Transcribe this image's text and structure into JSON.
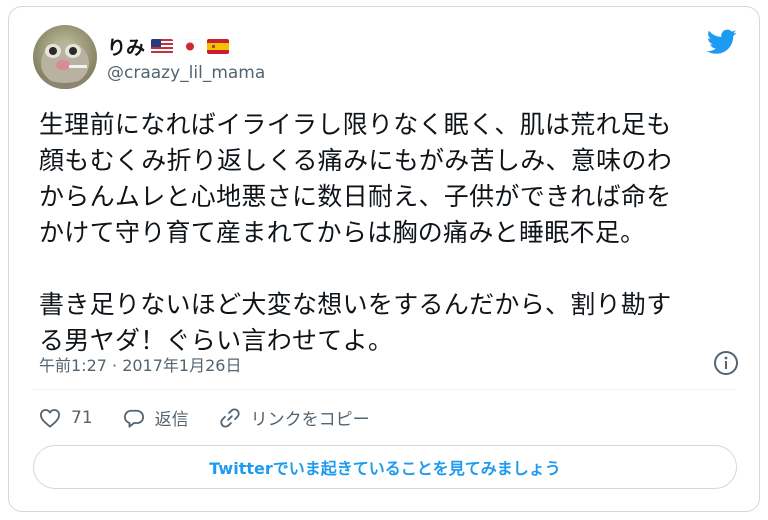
{
  "author": {
    "display_name": "りみ",
    "handle": "@craazy_lil_mama",
    "flags": [
      "us-flag",
      "jp-flag",
      "es-flag"
    ]
  },
  "tweet": {
    "text": "生理前になればイライラし限りなく眠く、肌は荒れ足も\n顔もむくみ折り返しくる痛みにもがみ苦しみ、意味のわ\nからんムレと心地悪さに数日耐え、子供ができれば命を\nかけて守り育て産まれてからは胸の痛みと睡眠不足。\n\n書き足りないほど大変な想いをするんだから、割り勘す\nる男ヤダ！ぐらい言わせてよ。",
    "timestamp": "午前1:27 · 2017年1月26日"
  },
  "actions": {
    "like_count": "71",
    "reply_label": "返信",
    "copy_link_label": "リンクをコピー"
  },
  "cta": {
    "label": "Twitterでいま起きていることを見てみましょう"
  },
  "colors": {
    "accent": "#1d9bf0",
    "secondary_text": "#536471",
    "border": "#cfd9de"
  },
  "icons": [
    "twitter-bird-icon",
    "info-icon",
    "heart-icon",
    "reply-icon",
    "link-icon"
  ]
}
